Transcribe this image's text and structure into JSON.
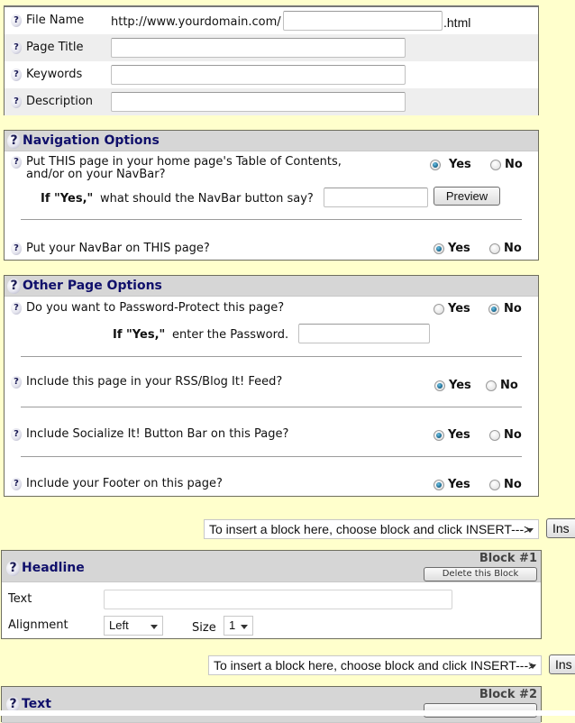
{
  "page_info": {
    "file_name_label": "File Name",
    "file_name_prefix": "http://www.yourdomain.com/",
    "file_name_value": "",
    "file_name_suffix": ".html",
    "page_title_label": "Page Title",
    "page_title_value": "",
    "keywords_label": "Keywords",
    "keywords_value": "",
    "description_label": "Description",
    "description_value": ""
  },
  "help_icon": "?",
  "navigation": {
    "title": "Navigation Options",
    "toc_question_line1": "Put THIS page in your home page's Table of Contents,",
    "toc_question_line2": "and/or on your NavBar?",
    "toc_choice": "Yes",
    "if_yes_bold": "If \"Yes,\"",
    "navbar_button_question": "what should the NavBar button say?",
    "navbar_button_value": "",
    "preview_label": "Preview",
    "navbar_on_page_question": "Put your NavBar on THIS page?",
    "navbar_on_page_choice": "Yes"
  },
  "radio_labels": {
    "yes": "Yes",
    "no": "No"
  },
  "other_options": {
    "title": "Other Page Options",
    "password_question": "Do you want to Password-Protect this page?",
    "password_choice": "No",
    "if_yes_bold": "If \"Yes,\"",
    "password_prompt": "enter the Password.",
    "password_value": "",
    "rss_question": "Include this page in your RSS/Blog It! Feed?",
    "rss_choice": "Yes",
    "socialize_question": "Include Socialize It! Button Bar on this Page?",
    "socialize_choice": "Yes",
    "footer_question": "Include your Footer on this page?",
    "footer_choice": "Yes"
  },
  "insert_bar": {
    "select_text": "To insert a block here, choose block and click INSERT--->",
    "button_label": "Ins"
  },
  "blocks": [
    {
      "title": "Headline",
      "number_label": "Block #1",
      "delete_label": "Delete this Block",
      "text_label": "Text",
      "text_value": "",
      "alignment_label": "Alignment",
      "alignment_value": "Left",
      "size_label": "Size",
      "size_value": "1"
    },
    {
      "title": "Text",
      "number_label": "Block #2"
    }
  ]
}
